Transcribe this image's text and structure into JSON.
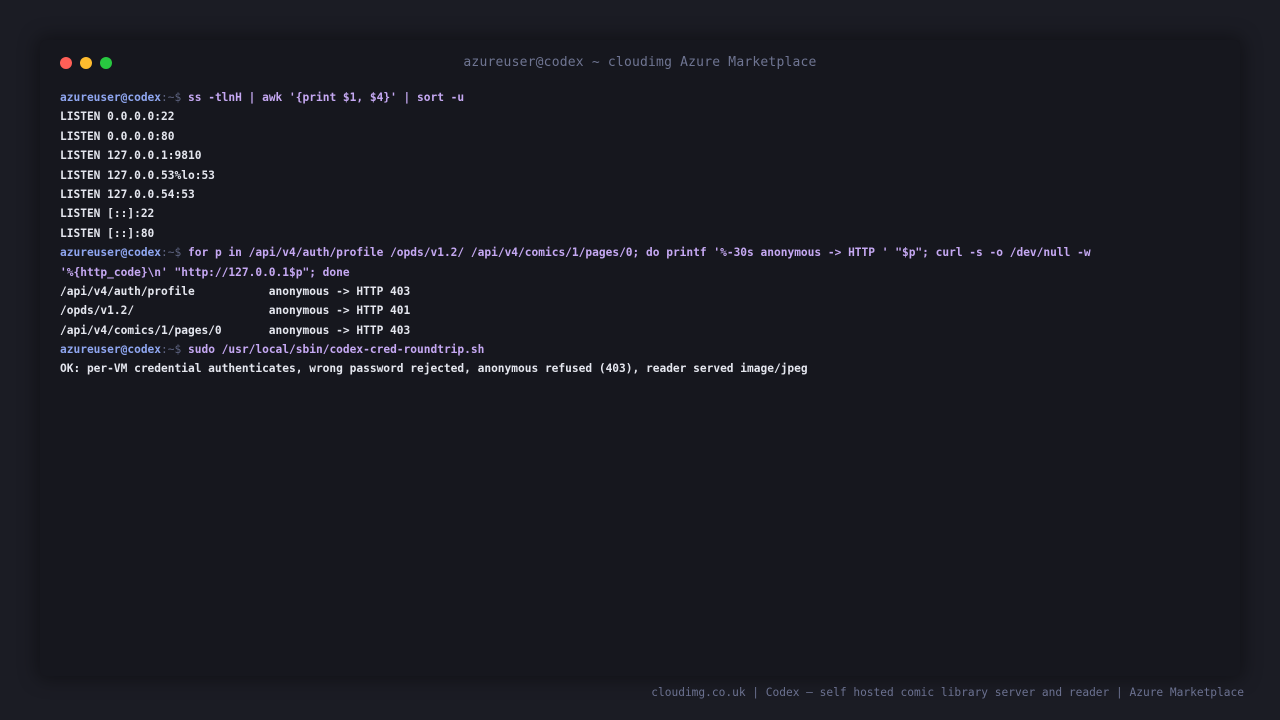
{
  "window": {
    "title": "azureuser@codex ~ cloudimg Azure Marketplace"
  },
  "prompt": {
    "user_host": "azureuser@codex",
    "path_symbol": ":~$ "
  },
  "session": [
    {
      "command": "ss -tlnH | awk '{print $1, $4}' | sort -u",
      "output": [
        "LISTEN 0.0.0.0:22",
        "LISTEN 0.0.0.0:80",
        "LISTEN 127.0.0.1:9810",
        "LISTEN 127.0.0.53%lo:53",
        "LISTEN 127.0.0.54:53",
        "LISTEN [::]:22",
        "LISTEN [::]:80"
      ]
    },
    {
      "command": "for p in /api/v4/auth/profile /opds/v1.2/ /api/v4/comics/1/pages/0; do printf '%-30s anonymous -> HTTP ' \"$p\"; curl -s -o /dev/null -w",
      "command_continuation": "'%{http_code}\\n' \"http://127.0.0.1$p\"; done",
      "output": [
        "/api/v4/auth/profile           anonymous -> HTTP 403",
        "/opds/v1.2/                    anonymous -> HTTP 401",
        "/api/v4/comics/1/pages/0       anonymous -> HTTP 403"
      ]
    },
    {
      "command": "sudo /usr/local/sbin/codex-cred-roundtrip.sh",
      "output": [
        "OK: per-VM credential authenticates, wrong password rejected, anonymous refused (403), reader served image/jpeg"
      ]
    }
  ],
  "footer": {
    "text": "cloudimg.co.uk | Codex — self hosted comic library server and reader | Azure Marketplace"
  }
}
